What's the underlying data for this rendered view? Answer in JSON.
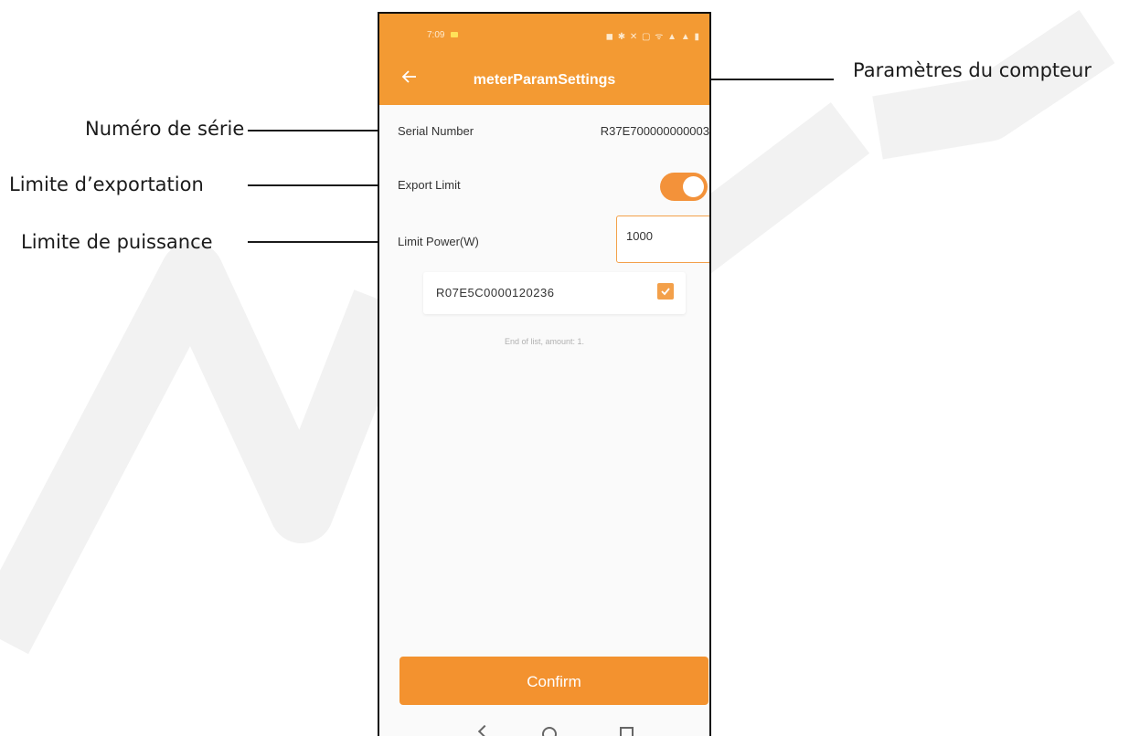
{
  "annotations": {
    "meter_settings": "Paramètres du compteur",
    "serial_number": "Numéro de série",
    "export_limit": "Limite d’exportation",
    "limit_power": "Limite de puissance"
  },
  "status_bar": {
    "time": "7:09",
    "icons": "◼ ✱ ✕ ▢ ᯤ ▲ ▲ ▮"
  },
  "app_bar": {
    "back_icon": "arrow-left-icon",
    "title": "meterParamSettings"
  },
  "form": {
    "serial_label": "Serial Number",
    "serial_value": "R37E700000000003",
    "export_label": "Export Limit",
    "export_enabled": true,
    "limit_label": "Limit Power(W)",
    "limit_value": "1000"
  },
  "devices": [
    {
      "id": "R07E5C0000120236",
      "checked": true
    }
  ],
  "list_footer": "End of list, amount: 1.",
  "confirm_label": "Confirm",
  "colors": {
    "accent": "#f39a33",
    "toggle": "#f3923a",
    "confirm": "#f3922f"
  }
}
